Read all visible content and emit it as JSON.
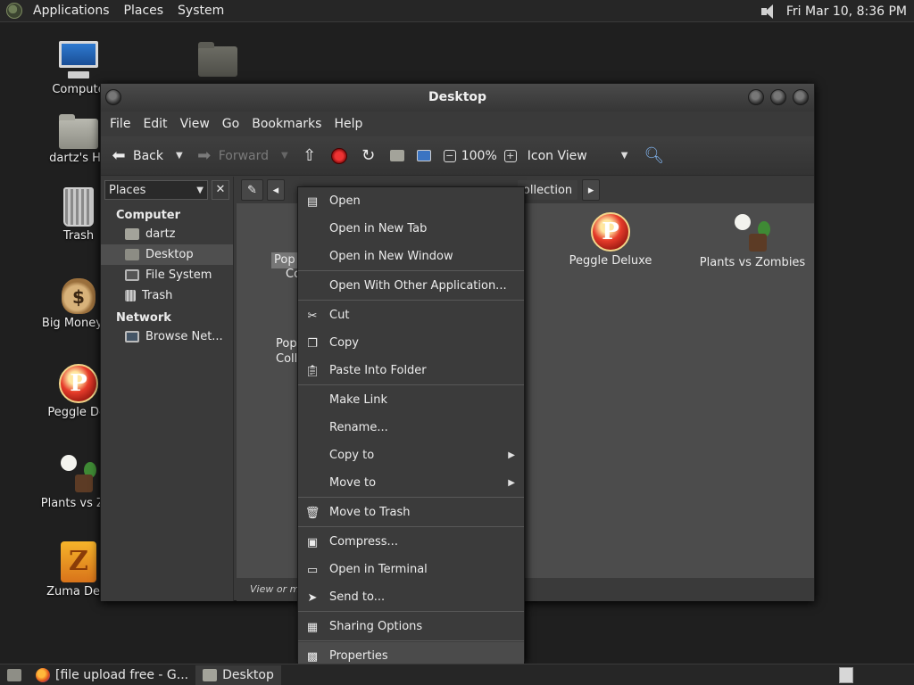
{
  "top_panel": {
    "menus": [
      "Applications",
      "Places",
      "System"
    ],
    "clock": "Fri Mar 10,  8:36 PM"
  },
  "desktop_icons": [
    {
      "label": "Compute",
      "icon": "computer-icon"
    },
    {
      "label": "dartz's Ho",
      "icon": "home-folder-icon"
    },
    {
      "label": "Trash",
      "icon": "trash-icon"
    },
    {
      "label": "Big Money D",
      "icon": "money-bag-icon"
    },
    {
      "label": "Peggle Del",
      "icon": "peggle-icon"
    },
    {
      "label": "Plants vs Zor",
      "icon": "plants-vs-zombies-icon"
    },
    {
      "label": "Zuma Delu",
      "icon": "zuma-icon"
    }
  ],
  "window": {
    "title": "Desktop",
    "menus": [
      "File",
      "Edit",
      "View",
      "Go",
      "Bookmarks",
      "Help"
    ],
    "toolbar": {
      "back": "Back",
      "forward": "Forward",
      "zoom": "100%",
      "view_mode": "Icon View"
    },
    "sidebar": {
      "combo": "Places",
      "close": "✕",
      "section_computer": "Computer",
      "section_network": "Network",
      "items": [
        {
          "label": "dartz",
          "icon": "home-icon"
        },
        {
          "label": "Desktop",
          "icon": "desktop-icon"
        },
        {
          "label": "File System",
          "icon": "filesystem-icon"
        },
        {
          "label": "Trash",
          "icon": "trash-icon"
        },
        {
          "label": "Browse Net...",
          "icon": "network-icon"
        }
      ]
    },
    "pathbar": {
      "visible_crumb": "ollection"
    },
    "files": [
      {
        "label": "Peggle Deluxe",
        "icon": "peggle-icon"
      },
      {
        "label": "Plants vs Zombies",
        "icon": "plants-vs-zombies-icon"
      }
    ],
    "obscured": {
      "file1_line1": "Pop",
      "file1_line2": "Co",
      "file2_line1": "Pop",
      "file2_line2": "Coll"
    },
    "status": "View or mo"
  },
  "context_menu": {
    "groups": [
      [
        {
          "label": "Open",
          "icon": "open-icon"
        },
        {
          "label": "Open in New Tab",
          "icon": ""
        },
        {
          "label": "Open in New Window",
          "icon": ""
        }
      ],
      [
        {
          "label": "Open With Other Application...",
          "icon": ""
        }
      ],
      [
        {
          "label": "Cut",
          "icon": "scissors-icon"
        },
        {
          "label": "Copy",
          "icon": "copy-icon"
        },
        {
          "label": "Paste Into Folder",
          "icon": "paste-icon"
        }
      ],
      [
        {
          "label": "Make Link",
          "icon": ""
        },
        {
          "label": "Rename...",
          "icon": ""
        },
        {
          "label": "Copy to",
          "icon": "",
          "submenu": true
        },
        {
          "label": "Move to",
          "icon": "",
          "submenu": true
        }
      ],
      [
        {
          "label": "Move to Trash",
          "icon": "trash-icon"
        }
      ],
      [
        {
          "label": "Compress...",
          "icon": "archive-icon"
        },
        {
          "label": "Open in Terminal",
          "icon": "terminal-icon"
        },
        {
          "label": "Send to...",
          "icon": "send-icon"
        }
      ],
      [
        {
          "label": "Sharing Options",
          "icon": "sharing-icon"
        }
      ],
      [
        {
          "label": "Properties",
          "icon": "properties-icon",
          "highlighted": true
        }
      ]
    ]
  },
  "taskbar": {
    "tasks": [
      {
        "label": "[file upload free - G...",
        "icon": "firefox-icon",
        "active": false
      },
      {
        "label": "Desktop",
        "icon": "folder-icon",
        "active": true
      }
    ]
  }
}
